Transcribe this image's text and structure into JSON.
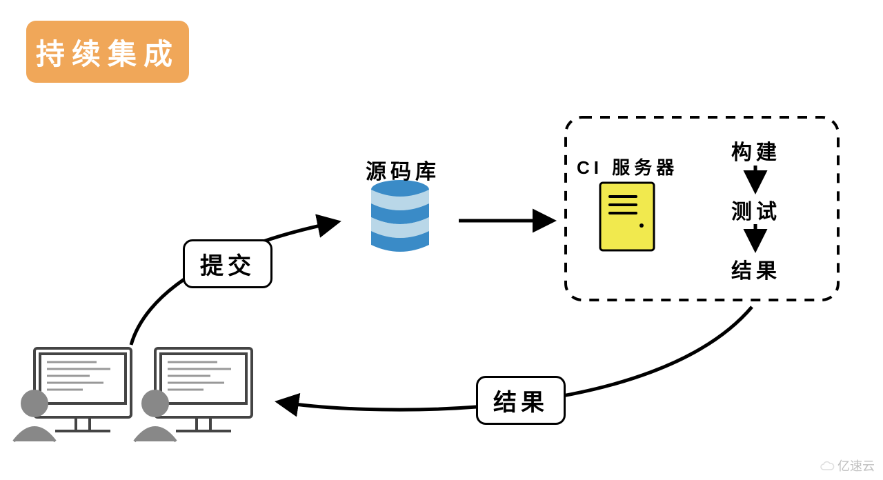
{
  "title": "持续集成",
  "nodes": {
    "developers": {
      "name": "developers-icon"
    },
    "commit": {
      "label": "提交"
    },
    "repo": {
      "label": "源码库"
    },
    "ci_box": {
      "server_label": "CI 服务器",
      "steps": [
        "构建",
        "测试",
        "结果"
      ]
    },
    "result_label": {
      "label": "结果"
    }
  },
  "arrows": [
    {
      "from": "developers",
      "to": "repo",
      "via": "commit"
    },
    {
      "from": "repo",
      "to": "ci_box"
    },
    {
      "from": "ci_box.step0",
      "to": "ci_box.step1"
    },
    {
      "from": "ci_box.step1",
      "to": "ci_box.step2"
    },
    {
      "from": "ci_box",
      "to": "developers",
      "via": "result_label"
    }
  ],
  "watermark": "亿速云"
}
